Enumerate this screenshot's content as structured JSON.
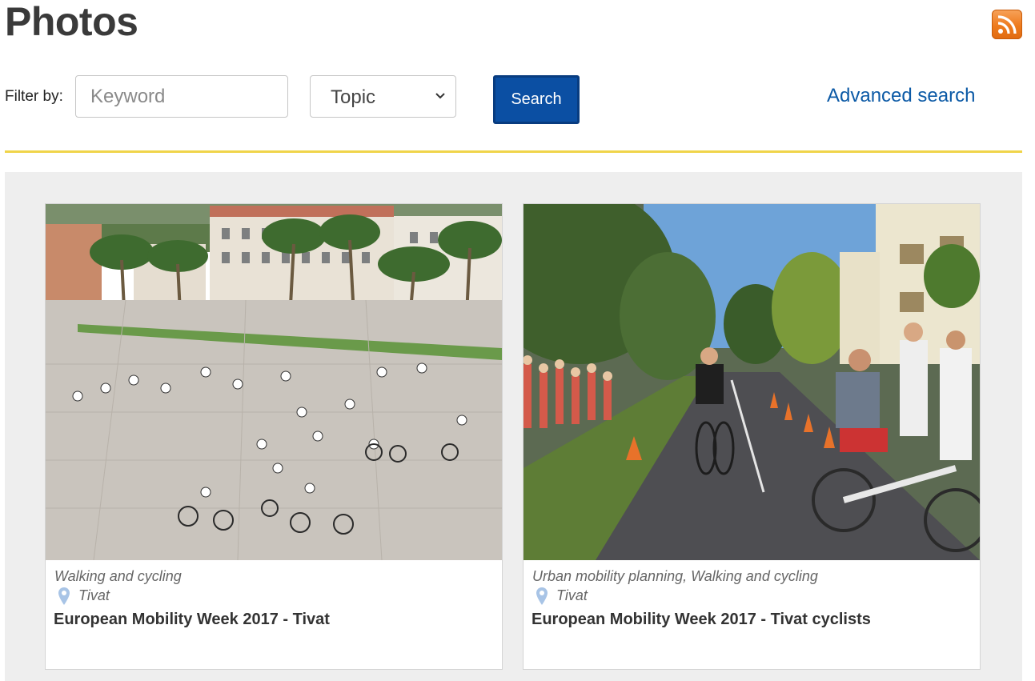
{
  "page": {
    "title": "Photos"
  },
  "rss": {
    "icon": "rss-icon",
    "color": "#ee7b1d"
  },
  "filter": {
    "label": "Filter by:",
    "keyword_placeholder": "Keyword",
    "keyword_value": "",
    "topic_selected": "Topic",
    "search_label": "Search",
    "advanced_search_label": "Advanced search"
  },
  "colors": {
    "accent_divider": "#f0d44a",
    "search_button": "#0b4fa3",
    "link": "#0c5aa6",
    "gallery_bg": "#eeeeee"
  },
  "photos": [
    {
      "topics": "Walking and cycling",
      "location": "Tivat",
      "title": "European Mobility Week 2017 - Tivat",
      "image": "photo of children on bicycles in a large paved town square with palm trees and buildings"
    },
    {
      "topics": "Urban mobility planning, Walking and cycling",
      "location": "Tivat",
      "title": "European Mobility Week 2017 - Tivat cyclists",
      "image": "photo of boys riding bicycles on a street course with traffic cones, trees and spectators"
    }
  ]
}
